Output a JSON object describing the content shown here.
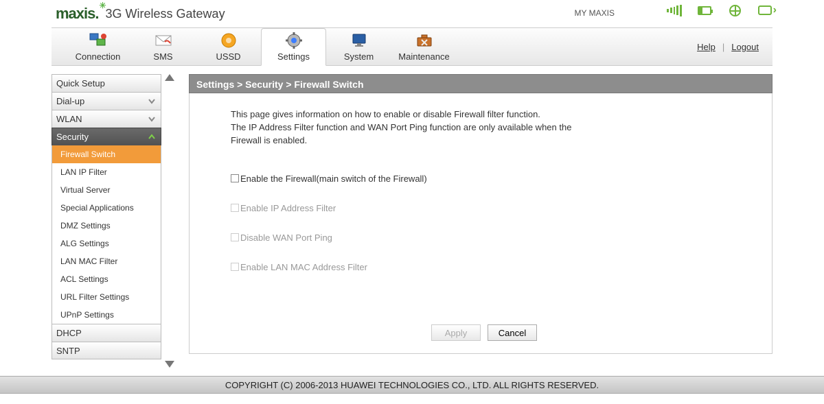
{
  "header": {
    "brand": "maxis",
    "title": "3G Wireless Gateway",
    "myaccount": "MY MAXIS"
  },
  "nav": {
    "items": [
      {
        "label": "Connection"
      },
      {
        "label": "SMS"
      },
      {
        "label": "USSD"
      },
      {
        "label": "Settings"
      },
      {
        "label": "System"
      },
      {
        "label": "Maintenance"
      }
    ],
    "help": "Help",
    "logout": "Logout"
  },
  "sidebar": {
    "items": [
      {
        "label": "Quick Setup",
        "type": "plain"
      },
      {
        "label": "Dial-up",
        "type": "expand"
      },
      {
        "label": "WLAN",
        "type": "expand"
      },
      {
        "label": "Security",
        "type": "head"
      },
      {
        "label": "DHCP",
        "type": "plain"
      },
      {
        "label": "SNTP",
        "type": "plain"
      }
    ],
    "security_children": [
      "Firewall Switch",
      "LAN IP Filter",
      "Virtual Server",
      "Special Applications",
      "DMZ Settings",
      "ALG Settings",
      "LAN MAC Filter",
      "ACL Settings",
      "URL Filter Settings",
      "UPnP Settings"
    ]
  },
  "breadcrumb": "Settings > Security > Firewall Switch",
  "description": "This page gives information on how to enable or disable Firewall filter function.\nThe IP Address Filter function and WAN Port Ping function are only available when the Firewall is enabled.",
  "options": [
    {
      "label": "Enable the Firewall(main switch of the Firewall)",
      "enabled": true
    },
    {
      "label": "Enable IP Address Filter",
      "enabled": false
    },
    {
      "label": "Disable WAN Port Ping",
      "enabled": false
    },
    {
      "label": "Enable LAN MAC Address Filter",
      "enabled": false
    }
  ],
  "buttons": {
    "apply": "Apply",
    "cancel": "Cancel"
  },
  "footer": "COPYRIGHT (C) 2006-2013 HUAWEI TECHNOLOGIES CO., LTD. ALL RIGHTS RESERVED."
}
